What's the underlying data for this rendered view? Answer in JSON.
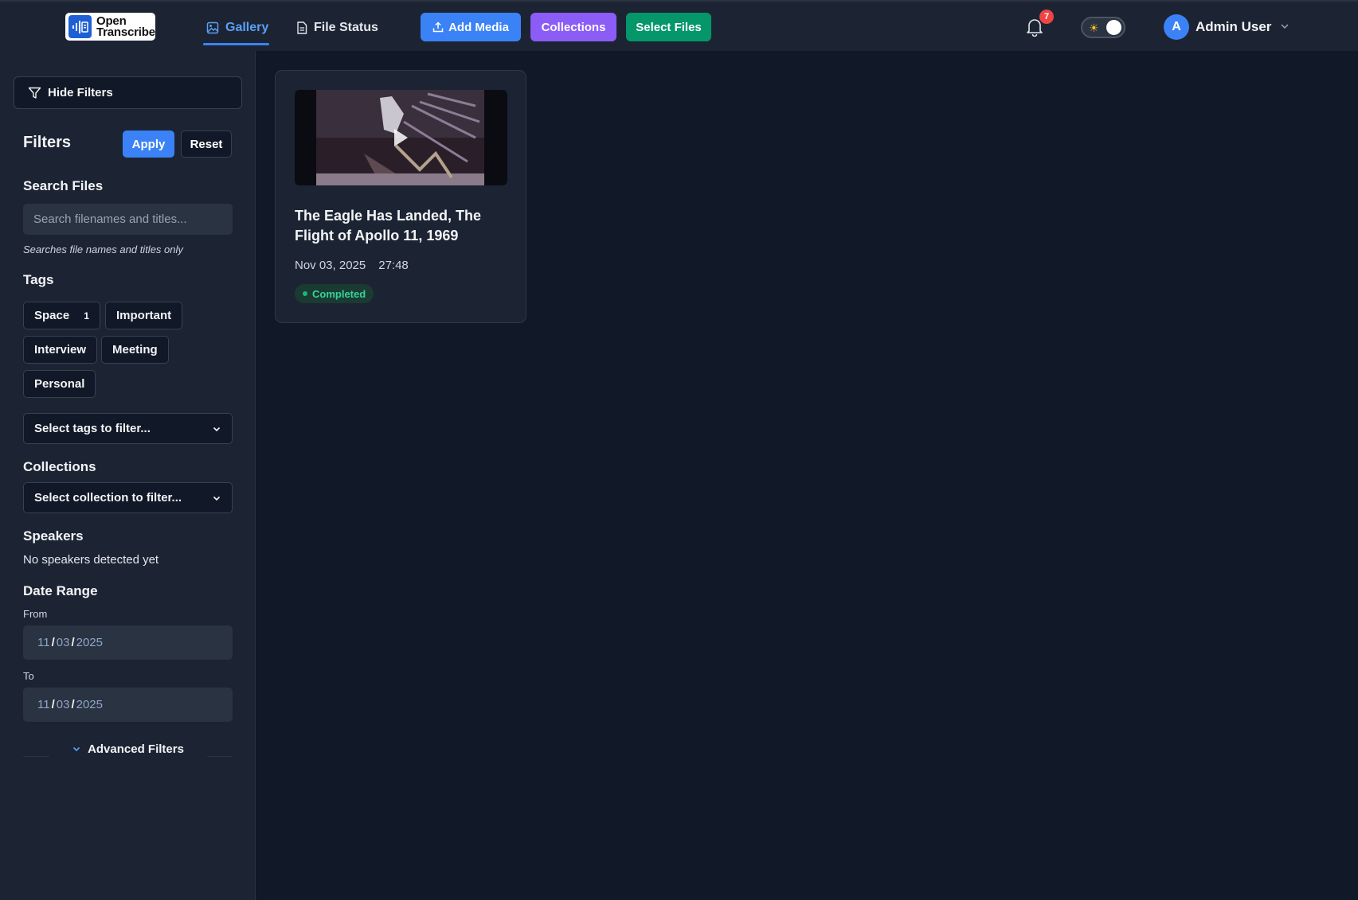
{
  "app": {
    "logo_line1": "Open",
    "logo_line2": "Transcribe"
  },
  "nav": {
    "gallery": "Gallery",
    "file_status": "File Status"
  },
  "actions": {
    "add_media": "Add Media",
    "collections": "Collections",
    "select_files": "Select Files"
  },
  "notifications": {
    "count": "7"
  },
  "theme_toggle": {
    "mode": "light",
    "icon": "sun-icon"
  },
  "user": {
    "initial": "A",
    "name": "Admin User"
  },
  "sidebar": {
    "hide_filters": "Hide Filters",
    "filters_title": "Filters",
    "apply": "Apply",
    "reset": "Reset",
    "search": {
      "title": "Search Files",
      "placeholder": "Search filenames and titles...",
      "hint": "Searches file names and titles only"
    },
    "tags": {
      "title": "Tags",
      "items": [
        {
          "label": "Space",
          "count": "1"
        },
        {
          "label": "Important"
        },
        {
          "label": "Interview"
        },
        {
          "label": "Meeting"
        },
        {
          "label": "Personal"
        }
      ],
      "select_placeholder": "Select tags to filter..."
    },
    "collections": {
      "title": "Collections",
      "select_placeholder": "Select collection to filter..."
    },
    "speakers": {
      "title": "Speakers",
      "empty": "No speakers detected yet"
    },
    "date_range": {
      "title": "Date Range",
      "from_label": "From",
      "from": {
        "month": "11",
        "day": "03",
        "year": "2025"
      },
      "to_label": "To",
      "to": {
        "month": "11",
        "day": "03",
        "year": "2025"
      }
    },
    "advanced": "Advanced Filters"
  },
  "gallery": {
    "items": [
      {
        "title": "The Eagle Has Landed, The Flight of Apollo 11, 1969",
        "date": "Nov 03, 2025",
        "duration": "27:48",
        "status": "Completed"
      }
    ]
  },
  "colors": {
    "accent": "#3b82f6",
    "collections": "#8b5cf6",
    "select_files": "#059669",
    "status_completed": "#34d399",
    "badge": "#ef4444"
  }
}
